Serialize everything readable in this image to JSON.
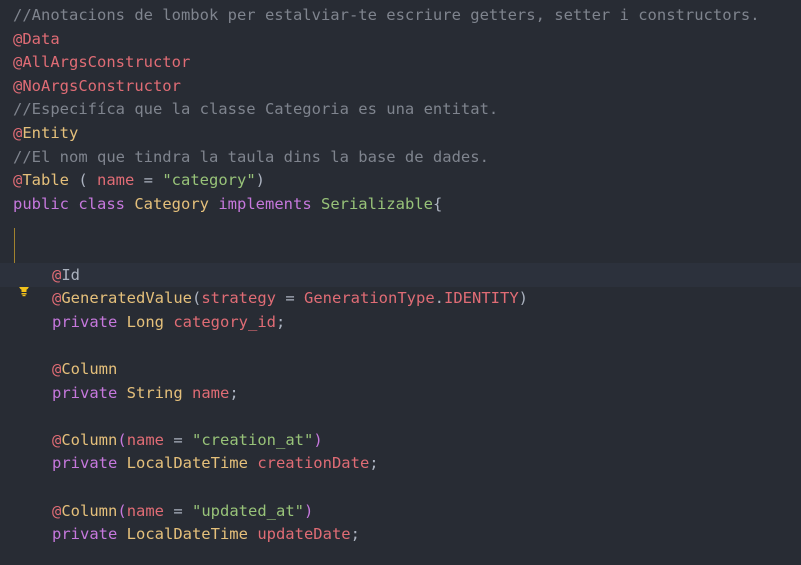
{
  "editor": {
    "lines": [
      {
        "tokens": [
          {
            "t": "//Anotacions de lombok per estalviar-te escriure getters, setter i constructors.",
            "c": "comment"
          }
        ]
      },
      {
        "tokens": [
          {
            "t": "@Data",
            "c": "anno"
          }
        ]
      },
      {
        "tokens": [
          {
            "t": "@AllArgsConstructor",
            "c": "anno"
          }
        ]
      },
      {
        "tokens": [
          {
            "t": "@NoArgsConstructor",
            "c": "anno"
          }
        ]
      },
      {
        "tokens": [
          {
            "t": "//Especifíca que la classe Categoria es una entitat.",
            "c": "comment"
          }
        ]
      },
      {
        "tokens": [
          {
            "t": "@",
            "c": "anno"
          },
          {
            "t": "Entity",
            "c": "anno-name"
          }
        ]
      },
      {
        "tokens": [
          {
            "t": "//El nom que tindra la taula dins la base de dades.",
            "c": "comment"
          }
        ]
      },
      {
        "tokens": [
          {
            "t": "@",
            "c": "anno"
          },
          {
            "t": "Table",
            "c": "anno-name"
          },
          {
            "t": " ( ",
            "c": "punct"
          },
          {
            "t": "name",
            "c": "param"
          },
          {
            "t": " = ",
            "c": "punct"
          },
          {
            "t": "\"category\"",
            "c": "string"
          },
          {
            "t": ")",
            "c": "punct"
          }
        ]
      },
      {
        "tokens": [
          {
            "t": "public class ",
            "c": "kw"
          },
          {
            "t": "Category ",
            "c": "type"
          },
          {
            "t": "implements ",
            "c": "kw"
          },
          {
            "t": "Serializable",
            "c": "iface"
          },
          {
            "t": "{",
            "c": "brace-hl"
          }
        ]
      },
      {
        "tokens": []
      },
      {
        "tokens": []
      },
      {
        "indent": true,
        "current": true,
        "tokens": [
          {
            "t": "@",
            "c": "anno"
          },
          {
            "t": "Id",
            "c": "id-box"
          }
        ]
      },
      {
        "indent": true,
        "tokens": [
          {
            "t": "@",
            "c": "anno"
          },
          {
            "t": "GeneratedValue",
            "c": "anno-name"
          },
          {
            "t": "(",
            "c": "punct"
          },
          {
            "t": "strategy",
            "c": "param"
          },
          {
            "t": " = ",
            "c": "punct"
          },
          {
            "t": "GenerationType",
            "c": "enum"
          },
          {
            "t": ".",
            "c": "punct"
          },
          {
            "t": "IDENTITY",
            "c": "enum"
          },
          {
            "t": ")",
            "c": "punct"
          }
        ]
      },
      {
        "indent": true,
        "tokens": [
          {
            "t": "private ",
            "c": "kw"
          },
          {
            "t": "Long ",
            "c": "type"
          },
          {
            "t": "category_id",
            "c": "field"
          },
          {
            "t": ";",
            "c": "punct"
          }
        ]
      },
      {
        "tokens": []
      },
      {
        "indent": true,
        "tokens": [
          {
            "t": "@",
            "c": "anno"
          },
          {
            "t": "Column",
            "c": "anno-name"
          }
        ]
      },
      {
        "indent": true,
        "tokens": [
          {
            "t": "private ",
            "c": "kw"
          },
          {
            "t": "String ",
            "c": "type"
          },
          {
            "t": "name",
            "c": "field"
          },
          {
            "t": ";",
            "c": "punct"
          }
        ]
      },
      {
        "tokens": []
      },
      {
        "indent": true,
        "tokens": [
          {
            "t": "@",
            "c": "anno"
          },
          {
            "t": "Column",
            "c": "anno-name"
          },
          {
            "t": "(",
            "c": "kw"
          },
          {
            "t": "name",
            "c": "param"
          },
          {
            "t": " = ",
            "c": "punct"
          },
          {
            "t": "\"creation_at\"",
            "c": "string"
          },
          {
            "t": ")",
            "c": "kw"
          }
        ]
      },
      {
        "indent": true,
        "tokens": [
          {
            "t": "private ",
            "c": "kw"
          },
          {
            "t": "LocalDateTime ",
            "c": "type"
          },
          {
            "t": "creationDate",
            "c": "field"
          },
          {
            "t": ";",
            "c": "punct"
          }
        ]
      },
      {
        "tokens": []
      },
      {
        "indent": true,
        "tokens": [
          {
            "t": "@",
            "c": "anno"
          },
          {
            "t": "Column",
            "c": "anno-name"
          },
          {
            "t": "(",
            "c": "kw"
          },
          {
            "t": "name",
            "c": "param"
          },
          {
            "t": " = ",
            "c": "punct"
          },
          {
            "t": "\"updated_at\"",
            "c": "string"
          },
          {
            "t": ")",
            "c": "kw"
          }
        ]
      },
      {
        "indent": true,
        "tokens": [
          {
            "t": "private ",
            "c": "kw"
          },
          {
            "t": "LocalDateTime ",
            "c": "type"
          },
          {
            "t": "updateDate",
            "c": "field"
          },
          {
            "t": ";",
            "c": "punct"
          }
        ]
      }
    ]
  },
  "gutter": {
    "lightbulb_icon": "lightbulb-icon"
  },
  "colors": {
    "background": "#282c34",
    "comment": "#7f848e",
    "annotation": "#e06c75",
    "keyword": "#c678dd",
    "type": "#e5c07b",
    "string": "#98c379"
  }
}
